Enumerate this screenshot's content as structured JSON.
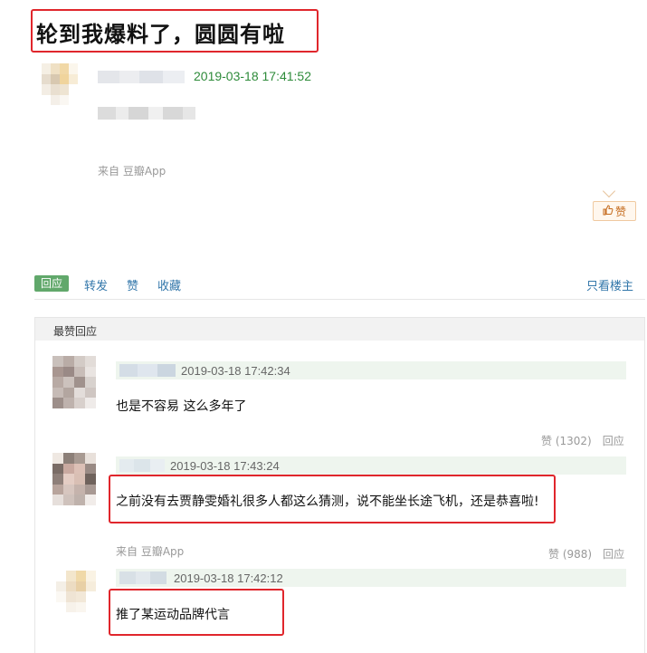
{
  "post": {
    "title": "轮到我爆料了，圆圆有啦",
    "timestamp": "2019-03-18 17:41:52",
    "source": "来自 豆瓣App",
    "like_label": "赞"
  },
  "actions": {
    "reply": "回应",
    "repost": "转发",
    "like": "赞",
    "collect": "收藏",
    "only_op": "只看楼主"
  },
  "section": {
    "top_replies_label": "最赞回应"
  },
  "comments": [
    {
      "timestamp": "2019-03-18 17:42:34",
      "text": "也是不容易 这么多年了",
      "likes": "赞 (1302)",
      "reply": "回应"
    },
    {
      "timestamp": "2019-03-18 17:43:24",
      "text": "之前没有去贾静雯婚礼很多人都这么猜测，说不能坐长途飞机，还是恭喜啦!",
      "source": "来自 豆瓣App",
      "likes": "赞 (988)",
      "reply": "回应"
    },
    {
      "timestamp": "2019-03-18 17:42:12",
      "text": "推了某运动品牌代言"
    }
  ],
  "colors": {
    "highlight_red": "#e0262c",
    "accent_green": "#61a86b",
    "link_blue": "#3377aa"
  }
}
